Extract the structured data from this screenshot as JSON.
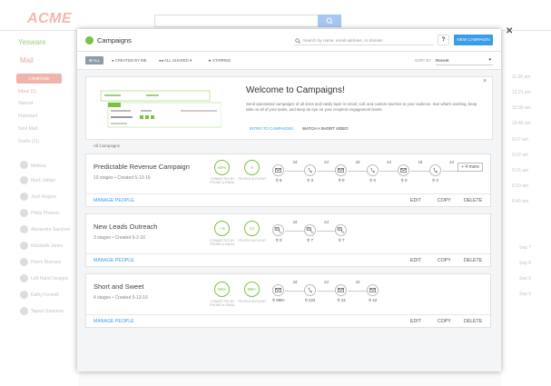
{
  "background": {
    "brand": "ACME",
    "search_icon": "search-icon",
    "app_name": "Yesware",
    "mail_label": "Mail",
    "compose": "COMPOSE",
    "nav": [
      "Inbox (1)",
      "Starred",
      "Important",
      "Sent Mail",
      "Drafts (11)"
    ],
    "user": "Melissa",
    "contacts": [
      "Mark Vallejo",
      "Josh Rogers",
      "Philip Phoenix",
      "Alexandra Sanchez",
      "Elizabeth Jones",
      "Pierre Burrows",
      "Left Hand Designs",
      "Kathy Fennell",
      "Tapani Saarinen"
    ],
    "times": [
      "11:06 am",
      "12:21 pm",
      "10:30 am",
      "10:45 am",
      "9:27 am",
      "9:22 am",
      "9:15 am",
      "9:10 am",
      "6:40 am",
      "Sep 7",
      "Sep 6",
      "Sep 6",
      "Sep 6"
    ]
  },
  "modal": {
    "title": "Campaigns",
    "search_placeholder": "Search by name, email address, or domain",
    "help": "?",
    "new_campaign": "NEW CAMPAIGN",
    "close": "✕",
    "filters": {
      "all": "ALL",
      "created_by_me": "CREATED BY ME",
      "all_shared": "ALL SHARED",
      "starred": "STARRED",
      "sort_by_label": "SORT BY",
      "sort_value": "Recent"
    },
    "welcome": {
      "title": "Welcome to Campaigns!",
      "text": "Send automated campaigns of all sizes and easily layer in email, call, and custom touches to your cadence. See what's working, keep tabs on all of your tasks, and keep an eye on your recipient engagement levels.",
      "link_intro": "INTRO TO CAMPAIGNS",
      "link_video": "WATCH A SHORT VIDEO",
      "close": "×"
    },
    "all_campaigns_label": "All Campaigns",
    "campaigns": [
      {
        "name": "Predictable Revenue Campaign",
        "stages": "10 stages",
        "created": "Created 5-13-16",
        "connected": "60%",
        "outlight": "9",
        "connected_label": "CONNECTED BY PHONE or EMAIL",
        "outlight_label": "PEOPLE IN FLIGHT",
        "steps": [
          {
            "type": "email",
            "count": "6"
          },
          {
            "type": "call",
            "count": "3"
          },
          {
            "type": "email",
            "count": "0"
          },
          {
            "type": "call",
            "count": "0"
          },
          {
            "type": "email",
            "count": "0"
          },
          {
            "type": "call",
            "count": "0"
          }
        ],
        "delays": [
          "2d",
          "2d",
          "2d",
          "2d",
          "2d",
          "2d"
        ],
        "more": "+ 4 more",
        "manage": "MANAGE PEOPLE",
        "edit": "EDIT",
        "copy": "COPY",
        "delete": "DELETE"
      },
      {
        "name": "New Leads Outreach",
        "stages": "3 stages",
        "created": "Created 6-2-16",
        "connected": "--%",
        "outlight": "14",
        "connected_label": "CONNECTED BY PHONE or EMAIL",
        "outlight_label": "PEOPLE IN FLIGHT",
        "steps": [
          {
            "type": "email-call",
            "count": "0"
          },
          {
            "type": "email-call",
            "count": "7"
          },
          {
            "type": "email-call",
            "count": "7"
          }
        ],
        "delays": [
          "2d",
          "2d"
        ],
        "manage": "MANAGE PEOPLE",
        "edit": "EDIT",
        "copy": "COPY",
        "delete": "DELETE"
      },
      {
        "name": "Short and Sweet",
        "stages": "4 stages",
        "created": "Created 5-13-16",
        "connected": "68%",
        "outlight": "999+",
        "connected_label": "CONNECTED BY PHONE or EMAIL",
        "outlight_label": "PEOPLE IN FLIGHT",
        "steps": [
          {
            "type": "email",
            "count": "999+"
          },
          {
            "type": "call",
            "count": "222"
          },
          {
            "type": "email",
            "count": "22"
          },
          {
            "type": "email",
            "count": "42"
          }
        ],
        "delays": [
          "2d",
          "2d",
          "2d"
        ],
        "manage": "MANAGE PEOPLE",
        "edit": "EDIT",
        "copy": "COPY",
        "delete": "DELETE"
      }
    ]
  },
  "colors": {
    "accent": "#3a9de6",
    "green": "#7dc142",
    "brand_faded": "#f1b8b2"
  }
}
